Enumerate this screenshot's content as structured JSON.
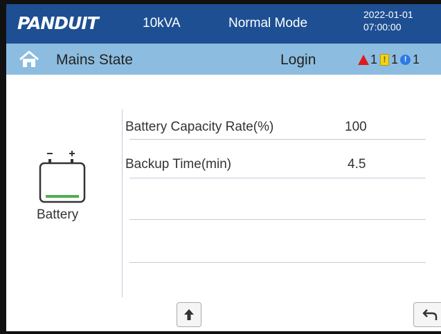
{
  "header": {
    "logo": "PANDUIT",
    "rating": "10kVA",
    "mode": "Normal Mode",
    "date": "2022-01-01",
    "time": "07:00:00"
  },
  "subheader": {
    "title": "Mains State",
    "login": "Login",
    "alarm_count": "1",
    "warning_count": "1",
    "info_count": "1",
    "warning_icon_glyph": "!",
    "info_icon_glyph": "!"
  },
  "battery": {
    "label": "Battery",
    "rows": [
      {
        "label": "Battery Capacity Rate(%)",
        "value": "100"
      },
      {
        "label": "Backup Time(min)",
        "value": "4.5"
      }
    ]
  },
  "colors": {
    "header_bg": "#1e4f93",
    "subheader_bg": "#8cbde0",
    "battery_level": "#4caf50"
  },
  "icons": [
    "home-icon",
    "alarm-icon",
    "warning-icon",
    "info-icon",
    "battery-icon",
    "up-arrow-icon",
    "back-icon"
  ]
}
